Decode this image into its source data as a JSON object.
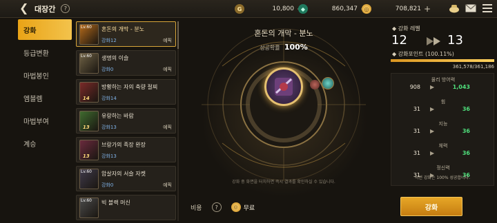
{
  "header": {
    "title": "대장간",
    "currencies": [
      {
        "icon": "gold-coin-icon",
        "value": "10,800"
      },
      {
        "icon": "green-gem-icon",
        "value": "860,347"
      },
      {
        "icon": "orange-coin-icon",
        "value": "708,821"
      }
    ]
  },
  "tabs": [
    "강화",
    "등급변환",
    "마법봉인",
    "엠블렘",
    "마법부여",
    "계승"
  ],
  "items": [
    {
      "name": "혼돈의 개막 - 분노",
      "thumb_level": "Lv.60",
      "level_text": "강화12",
      "slot": "예픽",
      "badge": "",
      "color": "#b46a1a",
      "selected": true
    },
    {
      "name": "생명의 이슬",
      "thumb_level": "Lv.60",
      "level_text": "강화0",
      "slot": "예픽",
      "badge": "",
      "color": "#6e6144",
      "selected": false
    },
    {
      "name": "방황하는 자의 축량 절찌",
      "thumb_level": "",
      "level_text": "강화14",
      "slot": "",
      "badge": "14",
      "color": "#7a2a28",
      "selected": false
    },
    {
      "name": "유랑하는 바람",
      "thumb_level": "",
      "level_text": "강화13",
      "slot": "예픽",
      "badge": "13",
      "color": "#3f6b2f",
      "selected": false
    },
    {
      "name": "브랑가의 족장 완장",
      "thumb_level": "",
      "level_text": "강화13",
      "slot": "",
      "badge": "13",
      "color": "#6a2a3d",
      "selected": false
    },
    {
      "name": "암살자의 서슬 자켓",
      "thumb_level": "Lv.60",
      "level_text": "강화0",
      "slot": "예픽",
      "badge": "",
      "color": "#3f3a4a",
      "selected": false
    },
    {
      "name": "빅 블랙 머신",
      "thumb_level": "Lv.60",
      "level_text": "",
      "slot": "",
      "badge": "",
      "color": "#4a4a4a",
      "selected": false
    }
  ],
  "center": {
    "item_title": "혼돈의 개막 - 분노",
    "rate_label": "성공확률",
    "rate_value": "100%",
    "note": "강화 중 화면을 터치하면 즉시 결과를 확인하실 수 있습니다.",
    "cost_label": "비용",
    "cost_help": "?",
    "cost_value": "무료"
  },
  "right": {
    "level_label": "강화 레벨",
    "level_from": "12",
    "level_to": "13",
    "points_label": "강화포인트 (100.11%)",
    "points_fraction": 1.0,
    "points_value": "361,578/361,186",
    "stats": [
      {
        "name": "물리 방어력",
        "from": "908",
        "to": "1,043"
      },
      {
        "name": "힘",
        "from": "31",
        "to": "36"
      },
      {
        "name": "지능",
        "from": "31",
        "to": "36"
      },
      {
        "name": "체력",
        "from": "31",
        "to": "36"
      },
      {
        "name": "정신력",
        "from": "31",
        "to": "36"
      }
    ],
    "note": "이번 강화는 100% 성공합니다.",
    "enhance_button": "강화"
  }
}
